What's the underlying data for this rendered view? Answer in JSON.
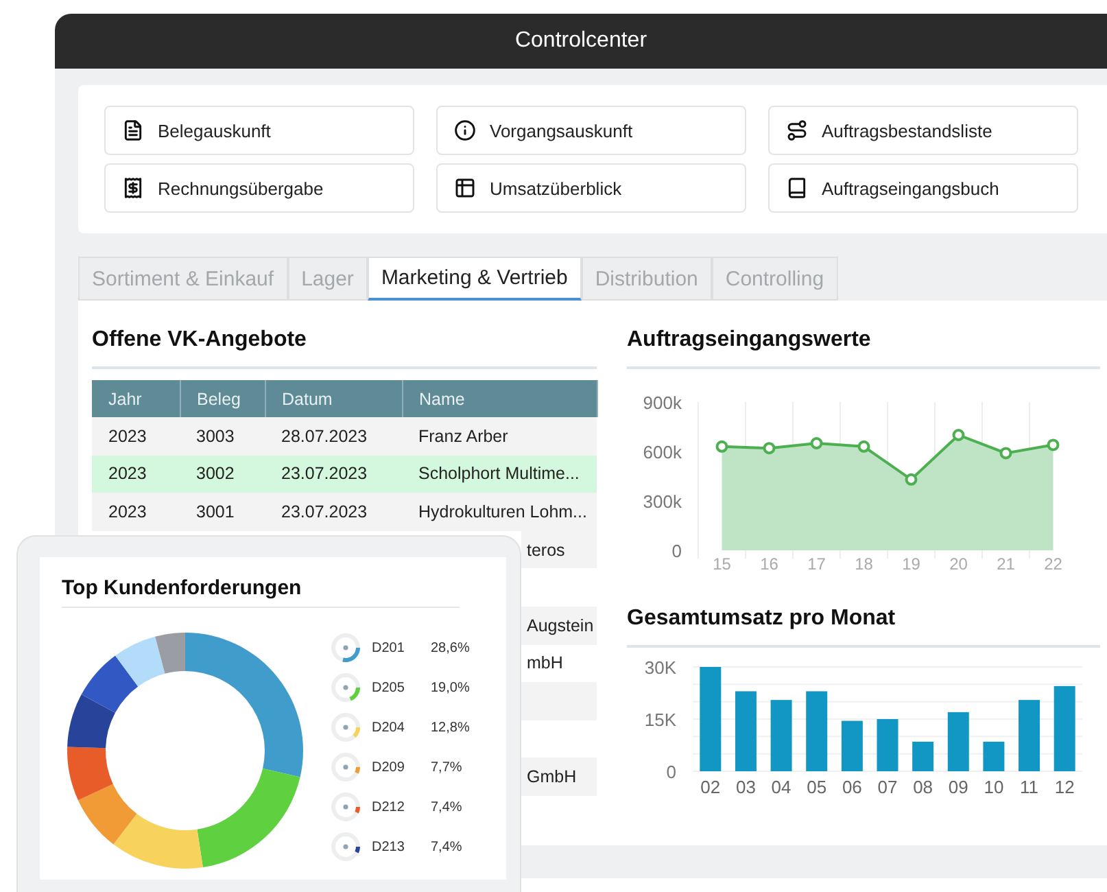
{
  "window": {
    "title": "Controlcenter"
  },
  "quick_links": [
    {
      "label": "Belegauskunft",
      "kind": "document"
    },
    {
      "label": "Vorgangsauskunft",
      "kind": "info"
    },
    {
      "label": "Auftragsbestandsliste",
      "kind": "route"
    },
    {
      "label": "Rechnungsübergabe",
      "kind": "receipt"
    },
    {
      "label": "Umsatzüberblick",
      "kind": "table"
    },
    {
      "label": "Auftragseingangsbuch",
      "kind": "book"
    }
  ],
  "tabs": [
    {
      "label": "Sortiment & Einkauf",
      "selected": false
    },
    {
      "label": "Lager",
      "selected": false
    },
    {
      "label": "Marketing & Vertrieb",
      "selected": true
    },
    {
      "label": "Distribution",
      "selected": false
    },
    {
      "label": "Controlling",
      "selected": false
    }
  ],
  "offers": {
    "title": "Offene VK-Angebote",
    "columns": [
      "Jahr",
      "Beleg",
      "Datum",
      "Name"
    ],
    "rows": [
      {
        "kind": "full",
        "selected": false,
        "cells": [
          "2023",
          "3003",
          "28.07.2023",
          "Franz Arber"
        ]
      },
      {
        "kind": "full",
        "selected": true,
        "cells": [
          "2023",
          "3002",
          "23.07.2023",
          "Scholphort Multime..."
        ]
      },
      {
        "kind": "full",
        "selected": false,
        "cells": [
          "2023",
          "3001",
          "23.07.2023",
          "Hydrokulturen Lohm..."
        ]
      },
      {
        "kind": "covered",
        "tail": "teros"
      },
      {
        "kind": "covered"
      },
      {
        "kind": "covered",
        "tail": "Augstein"
      },
      {
        "kind": "covered",
        "tail": "mbH"
      },
      {
        "kind": "covered"
      },
      {
        "kind": "covered"
      },
      {
        "kind": "covered",
        "tail": "GmbH"
      },
      {
        "kind": "covered"
      }
    ]
  },
  "order_values": {
    "title": "Auftragseingangswerte",
    "chart_data": {
      "type": "area",
      "categories": [
        "15",
        "16",
        "17",
        "18",
        "19",
        "20",
        "21",
        "22"
      ],
      "series": [
        {
          "color": "#4caf50",
          "values": [
            630000,
            620000,
            650000,
            630000,
            430000,
            700000,
            590000,
            640000
          ]
        }
      ],
      "ylim": [
        0,
        900000
      ],
      "yticks": [
        {
          "value": 0,
          "label": "0"
        },
        {
          "value": 300000,
          "label": "300k"
        },
        {
          "value": 600000,
          "label": "600k"
        },
        {
          "value": 900000,
          "label": "900k"
        }
      ]
    }
  },
  "monthly_revenue": {
    "title": "Gesamtumsatz pro Monat",
    "chart_data": {
      "type": "bar",
      "categories": [
        "02",
        "03",
        "04",
        "05",
        "06",
        "07",
        "08",
        "09",
        "10",
        "11",
        "12"
      ],
      "series": [
        {
          "color": "#1296c4",
          "values": [
            30000,
            23000,
            20500,
            23000,
            14500,
            15000,
            8500,
            17000,
            8500,
            20500,
            24500
          ]
        }
      ],
      "ylim": [
        0,
        30000
      ],
      "yticks": [
        {
          "value": 0,
          "label": "0"
        },
        {
          "value": 15000,
          "label": "15K"
        },
        {
          "value": 30000,
          "label": "30K"
        }
      ]
    }
  },
  "receivables": {
    "title": "Top Kundenforderungen",
    "chart_data": {
      "type": "donut",
      "categories": [
        "D201",
        "D205",
        "D204",
        "D209",
        "D212",
        "D213",
        null,
        null,
        null
      ],
      "values": [
        28.6,
        19.0,
        12.8,
        7.7,
        7.4,
        7.4,
        7.0,
        6.0,
        4.1
      ],
      "value_labels": [
        "28,6%",
        "19,0%",
        "12,8%",
        "7,7%",
        "7,4%",
        "7,4%",
        null,
        null,
        null
      ]
    },
    "slices": [
      {
        "color": "#3f9ccb"
      },
      {
        "color": "#5fd140"
      },
      {
        "color": "#f7d35d"
      },
      {
        "color": "#f19b37"
      },
      {
        "color": "#e85c2a"
      },
      {
        "color": "#27449a"
      },
      {
        "color": "#3258c4"
      },
      {
        "color": "#b3dcfa"
      },
      {
        "color": "#9a9ea4"
      }
    ]
  }
}
